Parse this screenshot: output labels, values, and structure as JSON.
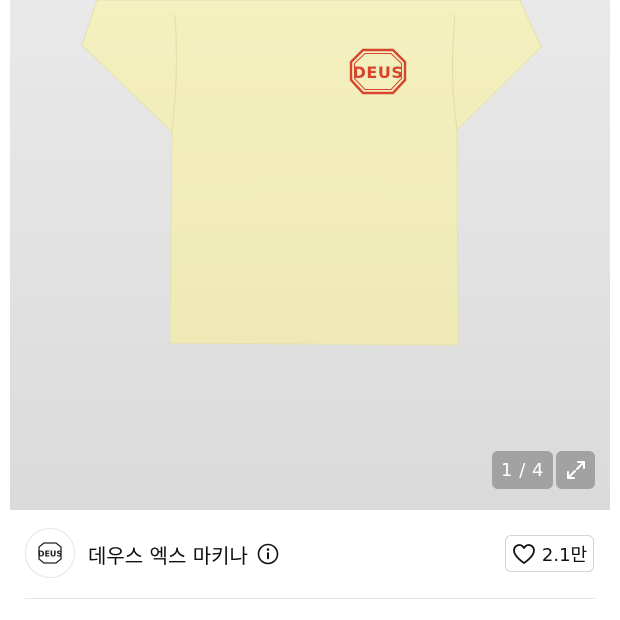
{
  "product": {
    "image_alt": "Yellow DEUS t-shirt",
    "shirt_color": "#f3efbd",
    "logo_color": "#d7462c",
    "logo_text": "DEUS"
  },
  "gallery": {
    "counter": "1 / 4",
    "expand_icon": "expand-icon"
  },
  "brand": {
    "name": "데우스 엑스 마키나",
    "logo_text": "DEUS",
    "info_icon": "info-icon"
  },
  "like": {
    "icon": "heart-icon",
    "count": "2.1만"
  }
}
